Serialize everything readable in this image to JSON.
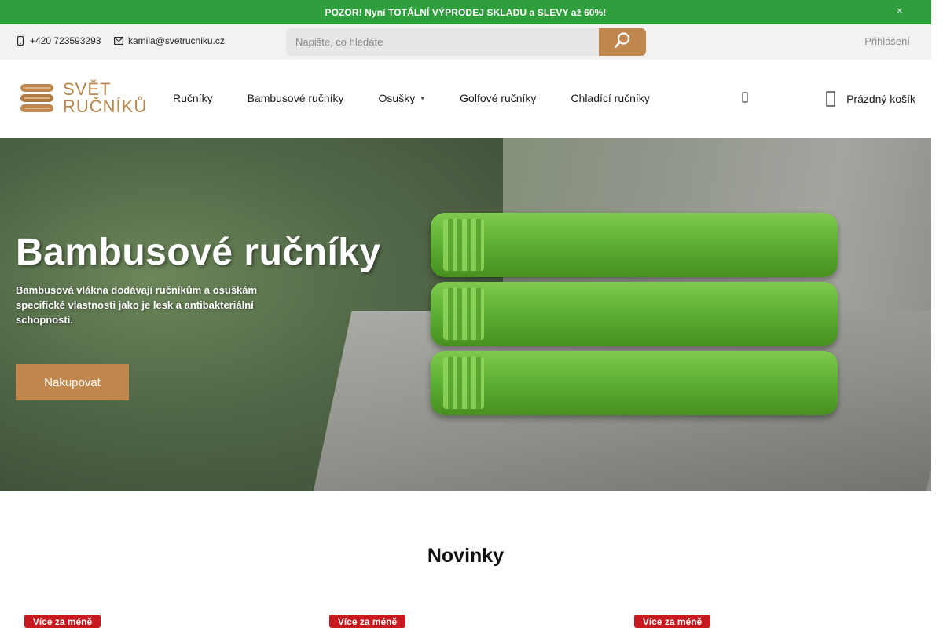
{
  "promo": {
    "text": "POZOR! Nyní TOTÁLNÍ VÝPRODEJ SKLADU a SLEVY až 60%!",
    "close_icon": "close-icon"
  },
  "topbar": {
    "phone": "+420 723593293",
    "email": "kamila@svetrucniku.cz",
    "search_placeholder": "Napište, co hledáte",
    "search_icon": "search-icon",
    "login": "Přihlášení"
  },
  "header": {
    "logo_line1": "SVĚT",
    "logo_line2": "RUČNÍKŮ",
    "nav": [
      {
        "label": "Ručníky"
      },
      {
        "label": "Bambusové ručníky"
      },
      {
        "label": "Osušky",
        "has_dropdown": true
      },
      {
        "label": "Golfové ručníky"
      },
      {
        "label": "Chladící ručníky"
      }
    ],
    "more_icon": "more-menu-icon",
    "cart_label": "Prázdný košík",
    "cart_icon": "cart-icon"
  },
  "hero": {
    "title": "Bambusové ručníky",
    "description": "Bambusová vlákna dodávají ručníkům a osuškám specifické vlastnosti jako je lesk a antibakteriální schopnosti.",
    "button": "Nakupovat"
  },
  "section": {
    "title": "Novinky"
  },
  "badges": [
    "Více za méně",
    "Více za méně",
    "Více za méně"
  ],
  "colors": {
    "promo_bg": "#2f9f3e",
    "accent": "#c0874e",
    "badge_red": "#c7191f",
    "topbar_bg": "#f2f2f2"
  }
}
